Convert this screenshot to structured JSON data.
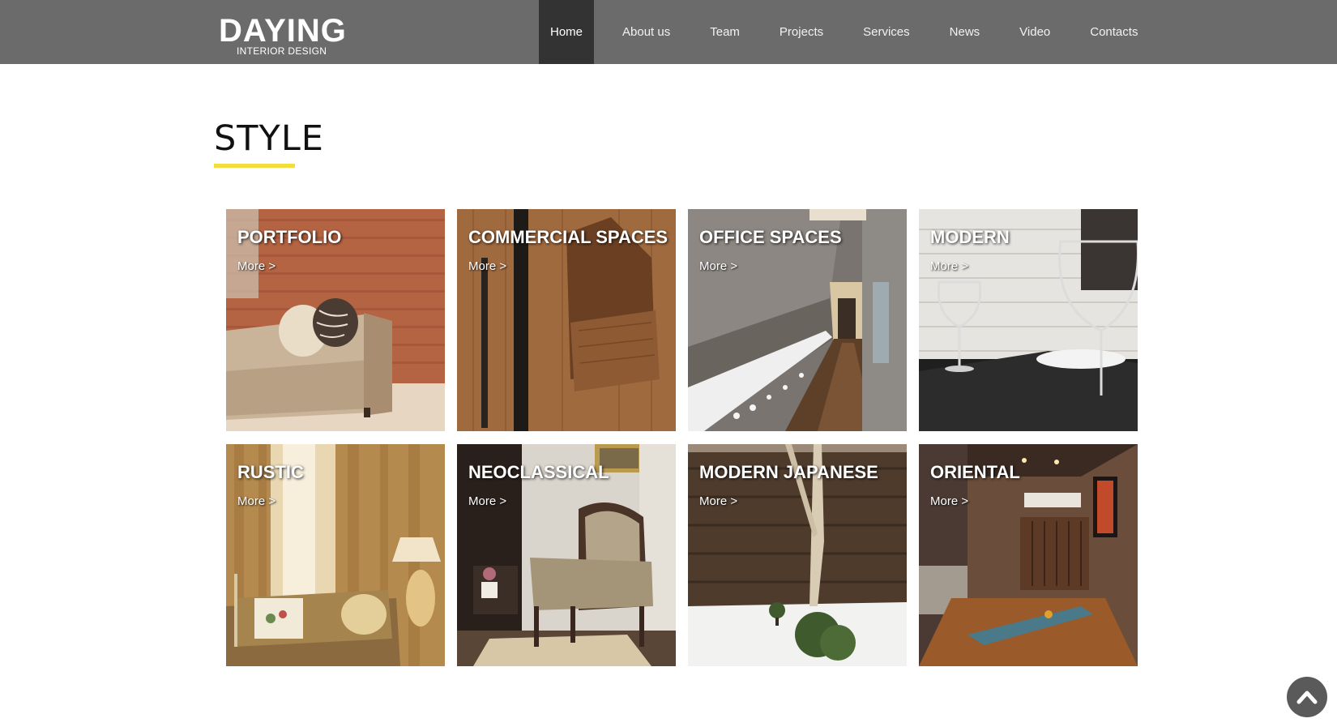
{
  "brand": {
    "name": "DAYING",
    "tagline": "INTERIOR DESIGN"
  },
  "nav": {
    "items": [
      {
        "label": "Home",
        "active": true
      },
      {
        "label": "About us"
      },
      {
        "label": "Team"
      },
      {
        "label": "Projects"
      },
      {
        "label": "Services"
      },
      {
        "label": "News"
      },
      {
        "label": "Video"
      },
      {
        "label": "Contacts"
      }
    ]
  },
  "section": {
    "title": "STYLE",
    "accent_color": "#f2dd3c"
  },
  "tiles": [
    {
      "title": "PORTFOLIO",
      "more": "More >"
    },
    {
      "title": "COMMERCIAL SPACES",
      "more": "More >"
    },
    {
      "title": "OFFICE SPACES",
      "more": "More >"
    },
    {
      "title": "MODERN",
      "more": "More >"
    },
    {
      "title": "RUSTIC",
      "more": "More >"
    },
    {
      "title": "NEOCLASSICAL",
      "more": "More >"
    },
    {
      "title": "MODERN JAPANESE",
      "more": "More >"
    },
    {
      "title": "ORIENTAL",
      "more": "More >"
    }
  ],
  "colors": {
    "header_bg": "#6b6b6b",
    "nav_active_bg": "#333333",
    "scroll_button_bg": "#5a5a5a"
  },
  "icons": {
    "scroll_top": "chevron-up-icon"
  }
}
